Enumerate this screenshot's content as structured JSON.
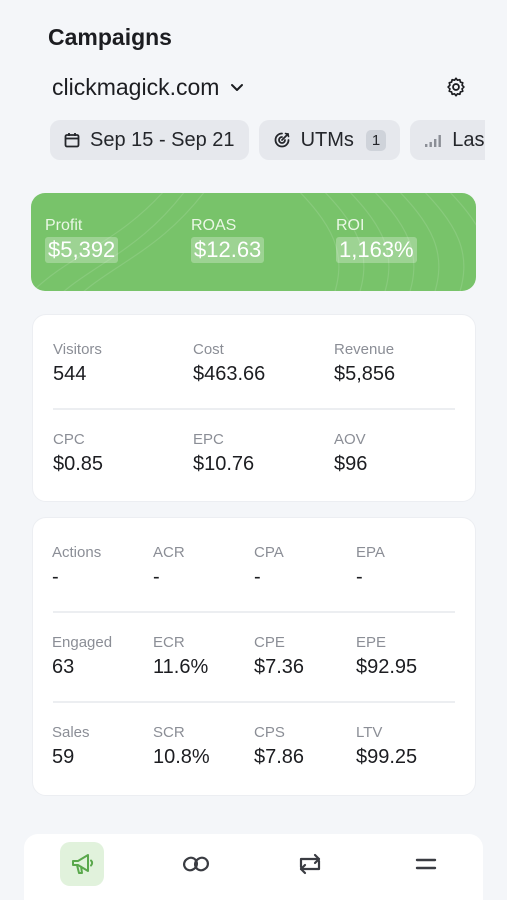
{
  "header": {
    "title": "Campaigns",
    "domain": "clickmagick.com"
  },
  "filters": {
    "date_range": "Sep 15 - Sep 21",
    "utms_label": "UTMs",
    "utms_count": "1",
    "third_label": "Las"
  },
  "summary": {
    "profit": {
      "label": "Profit",
      "value": "$5,392"
    },
    "roas": {
      "label": "ROAS",
      "value": "$12.63"
    },
    "roi": {
      "label": "ROI",
      "value": "1,163%"
    }
  },
  "traffic": {
    "visitors": {
      "label": "Visitors",
      "value": "544"
    },
    "cost": {
      "label": "Cost",
      "value": "$463.66"
    },
    "revenue": {
      "label": "Revenue",
      "value": "$5,856"
    },
    "cpc": {
      "label": "CPC",
      "value": "$0.85"
    },
    "epc": {
      "label": "EPC",
      "value": "$10.76"
    },
    "aov": {
      "label": "AOV",
      "value": "$96"
    }
  },
  "conversions": {
    "actions": {
      "label": "Actions",
      "value": "-"
    },
    "acr": {
      "label": "ACR",
      "value": "-"
    },
    "cpa": {
      "label": "CPA",
      "value": "-"
    },
    "epa": {
      "label": "EPA",
      "value": "-"
    },
    "engaged": {
      "label": "Engaged",
      "value": "63"
    },
    "ecr": {
      "label": "ECR",
      "value": "11.6%"
    },
    "cpe": {
      "label": "CPE",
      "value": "$7.36"
    },
    "epe": {
      "label": "EPE",
      "value": "$92.95"
    },
    "sales": {
      "label": "Sales",
      "value": "59"
    },
    "scr": {
      "label": "SCR",
      "value": "10.8%"
    },
    "cps": {
      "label": "CPS",
      "value": "$7.86"
    },
    "ltv": {
      "label": "LTV",
      "value": "$99.25"
    }
  },
  "colors": {
    "accent_green": "#78c36a",
    "active_tab_bg": "#e1f2dc",
    "chip_bg": "#e6e8ed"
  },
  "tabbar": {
    "items": [
      {
        "icon": "megaphone-icon",
        "active": true
      },
      {
        "icon": "link-icon",
        "active": false
      },
      {
        "icon": "repeat-icon",
        "active": false
      },
      {
        "icon": "menu-icon",
        "active": false
      }
    ]
  }
}
